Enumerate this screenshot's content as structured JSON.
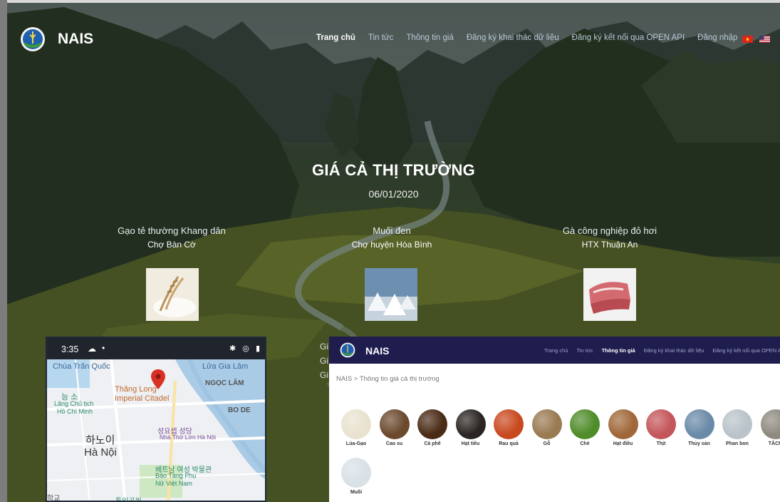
{
  "nav": {
    "brand": "NAIS",
    "items": [
      "Trang chủ",
      "Tin tức",
      "Thông tin giá",
      "Đăng ký khai thác dữ liệu",
      "Đăng ký kết nối qua OPEN API",
      "Đăng nhập"
    ],
    "active_index": 0
  },
  "hero": {
    "title": "GIÁ CẢ THỊ TRƯỜNG",
    "date": "06/01/2020",
    "cards": [
      {
        "name": "Gạo tẻ thường Khang dân",
        "location": "Chợ Bàn Cờ",
        "icon": "rice-image"
      },
      {
        "name": "Muối đen",
        "location": "Chợ huyện Hòa Bình",
        "icon": "salt-image"
      },
      {
        "name": "Gà công nghiệp đỏ hơi",
        "location": "HTX Thuận An",
        "icon": "meat-image"
      }
    ],
    "partial_lines": [
      "Gi",
      "Gi",
      "Gi"
    ]
  },
  "phone": {
    "time": "3:35",
    "status_icons": "✱ ◎ ▮",
    "map_labels": {
      "tran_quoc": "Chùa Trấn Quốc",
      "lua_gia_lam": "Lửa Gia Lâm",
      "thang_long": "Thăng Long",
      "imperial_citadel": "Imperial Citadel",
      "ngoc_lam": "NGỌC LÂM",
      "lang_chu_tich_ko": "능 소",
      "lang_chu_tich": "Lăng Chủ tịch",
      "ho_chi_minh": "Hồ Chí Minh",
      "bo_de": "BO DE",
      "hanoi_ko": "하노이",
      "hanoi": "Hà Nội",
      "cathedral_ko": "성요셉 성당",
      "cathedral": "Nhà Thờ Lớn Hà Nội",
      "museum_ko": "베트남 여성 박물관",
      "museum": "Bảo Tàng Phụ",
      "museum2": "Nữ Việt Nam",
      "school_ko": "학교",
      "park_ko": "통일공원"
    }
  },
  "site": {
    "brand": "NAIS",
    "menu": [
      "Trang chủ",
      "Tin tức",
      "Thông tin giá",
      "Đăng ký khai thác dữ liệu",
      "Đăng ký kết nối qua OPEN API"
    ],
    "active_index": 2,
    "breadcrumb": "NAIS > Thông tin giá cả thị trường",
    "categories": [
      {
        "label": "Lúa-Gạo",
        "icon": "rice-icon",
        "color": "#e9e2cf"
      },
      {
        "label": "Cao su",
        "icon": "rubber-icon",
        "color": "#6b4a2e"
      },
      {
        "label": "Cà phê",
        "icon": "coffee-icon",
        "color": "#4a2b16"
      },
      {
        "label": "Hạt tiêu",
        "icon": "pepper-icon",
        "color": "#2a2522"
      },
      {
        "label": "Rau quả",
        "icon": "vegetables-icon",
        "color": "#c9491f"
      },
      {
        "label": "Gỗ",
        "icon": "wood-icon",
        "color": "#9a7a52"
      },
      {
        "label": "Chè",
        "icon": "tea-icon",
        "color": "#4f8c2a"
      },
      {
        "label": "Hạt điều",
        "icon": "cashew-icon",
        "color": "#a0683a"
      },
      {
        "label": "Thịt",
        "icon": "meat-icon",
        "color": "#c4565a"
      },
      {
        "label": "Thủy sản",
        "icon": "seafood-icon",
        "color": "#6a8aa8"
      },
      {
        "label": "Phan bon",
        "icon": "fertilizer-icon",
        "color": "#b9c3c9"
      },
      {
        "label": "TĂCN",
        "icon": "feed-icon",
        "color": "#8f8a80"
      },
      {
        "label": "Muối",
        "icon": "salt-icon",
        "color": "#d9e1e6"
      }
    ]
  }
}
